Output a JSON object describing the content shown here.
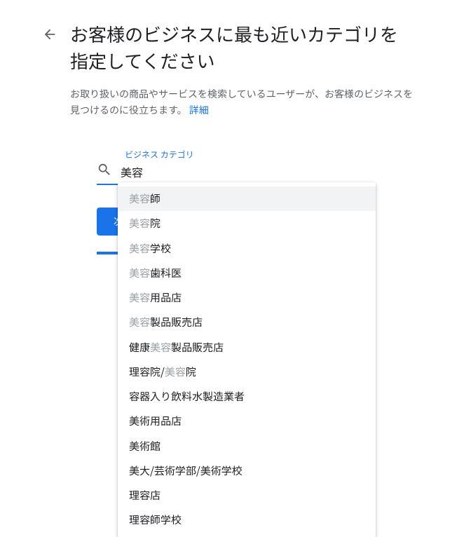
{
  "header": {
    "title": "お客様のビジネスに最も近いカテゴリを指定してください",
    "subtitle_pre": "お取り扱いの商品やサービスを検索しているユーザーが、お客様のビジネスを見つけるのに役立ちます。",
    "details_link": "詳細"
  },
  "search": {
    "label": "ビジネス カテゴリ",
    "value": "美容",
    "query": "美容"
  },
  "suggestions": [
    {
      "pre": "",
      "match": "美容",
      "post": "師",
      "highlighted": true
    },
    {
      "pre": "",
      "match": "美容",
      "post": "院",
      "highlighted": false
    },
    {
      "pre": "",
      "match": "美容",
      "post": "学校",
      "highlighted": false
    },
    {
      "pre": "",
      "match": "美容",
      "post": "歯科医",
      "highlighted": false
    },
    {
      "pre": "",
      "match": "美容",
      "post": "用品店",
      "highlighted": false
    },
    {
      "pre": "",
      "match": "美容",
      "post": "製品販売店",
      "highlighted": false
    },
    {
      "pre": "健康",
      "match": "美容",
      "post": "製品販売店",
      "highlighted": false
    },
    {
      "pre": "理容院/",
      "match": "美容",
      "post": "院",
      "highlighted": false
    },
    {
      "pre": "容器入り飲料水製造業者",
      "match": "",
      "post": "",
      "highlighted": false
    },
    {
      "pre": "美術用品店",
      "match": "",
      "post": "",
      "highlighted": false
    },
    {
      "pre": "美術館",
      "match": "",
      "post": "",
      "highlighted": false
    },
    {
      "pre": "美大/芸術学部/美術学校",
      "match": "",
      "post": "",
      "highlighted": false
    },
    {
      "pre": "理容店",
      "match": "",
      "post": "",
      "highlighted": false
    },
    {
      "pre": "理容師学校",
      "match": "",
      "post": "",
      "highlighted": false
    }
  ],
  "actions": {
    "next_label": "次へ"
  }
}
